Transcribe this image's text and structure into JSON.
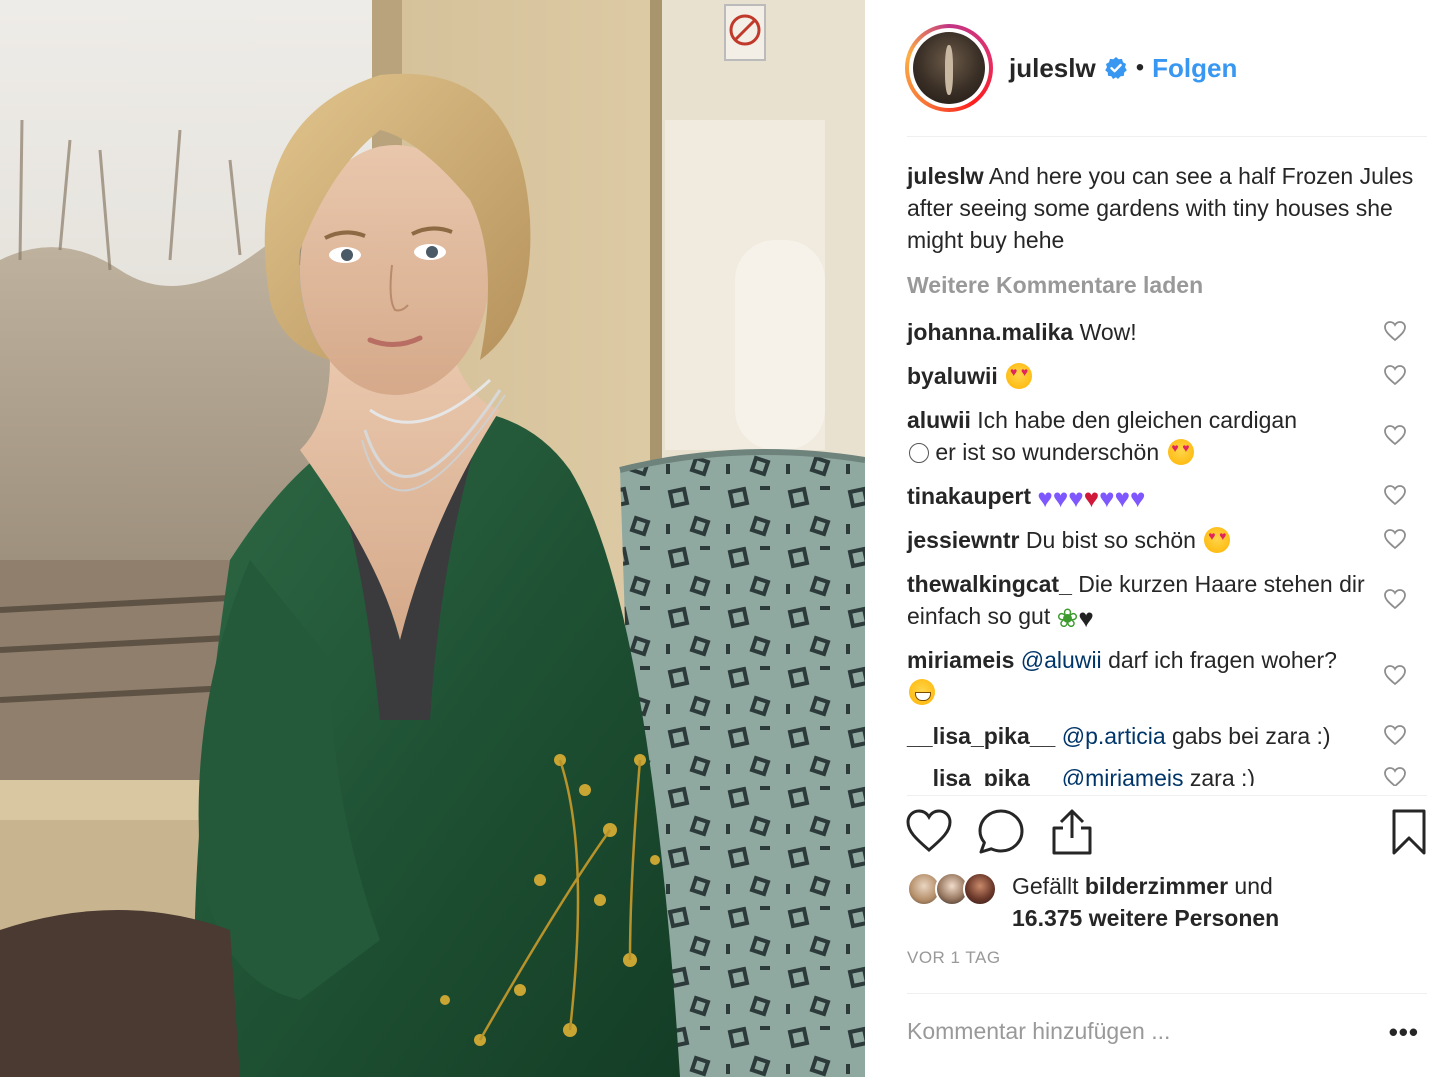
{
  "post": {
    "image_alt": "Photo of a young woman with short blonde hair in a green embroidered robe sitting by a train window"
  },
  "header": {
    "username": "juleslw",
    "verified_icon": "verified-badge-icon",
    "separator": "•",
    "follow_label": "Folgen",
    "follow_color": "#3897f0"
  },
  "caption": {
    "username": "juleslw",
    "text": "And here you can see a half Frozen Jules after seeing some gardens with tiny houses she might buy hehe"
  },
  "load_more_label": "Weitere Kommentare laden",
  "comments": [
    {
      "username": "johanna.malika",
      "text": "Wow!"
    },
    {
      "username": "byaluwii",
      "text": ""
    },
    {
      "username": "aluwii",
      "text": "Ich habe den gleichen cardigan",
      "text2": "er ist so wunderschön"
    },
    {
      "username": "tinakaupert",
      "text": ""
    },
    {
      "username": "jessiewntr",
      "text": "Du bist so schön"
    },
    {
      "username": "thewalkingcat_",
      "text": "Die kurzen Haare stehen dir einfach so gut"
    },
    {
      "username": "miriameis",
      "mention": "@aluwii",
      "text": "darf ich fragen woher?"
    },
    {
      "username": "__lisa_pika__",
      "mention": "@p.articia",
      "text": "gabs bei zara :)"
    },
    {
      "username": "__lisa_pika__",
      "mention": "@miriameis",
      "text": "zara :)"
    }
  ],
  "likes": {
    "prefix": "Gefällt",
    "first_user": "bilderzimmer",
    "conjunction": "und",
    "count": "16.375 weitere Personen"
  },
  "timestamp": "VOR 1 TAG",
  "add_comment": {
    "placeholder": "Kommentar hinzufügen ...",
    "more": "•••"
  },
  "colors": {
    "text": "#262626",
    "secondary": "#999999",
    "link": "#3897f0",
    "mention": "#003569",
    "divider": "#efefef"
  }
}
